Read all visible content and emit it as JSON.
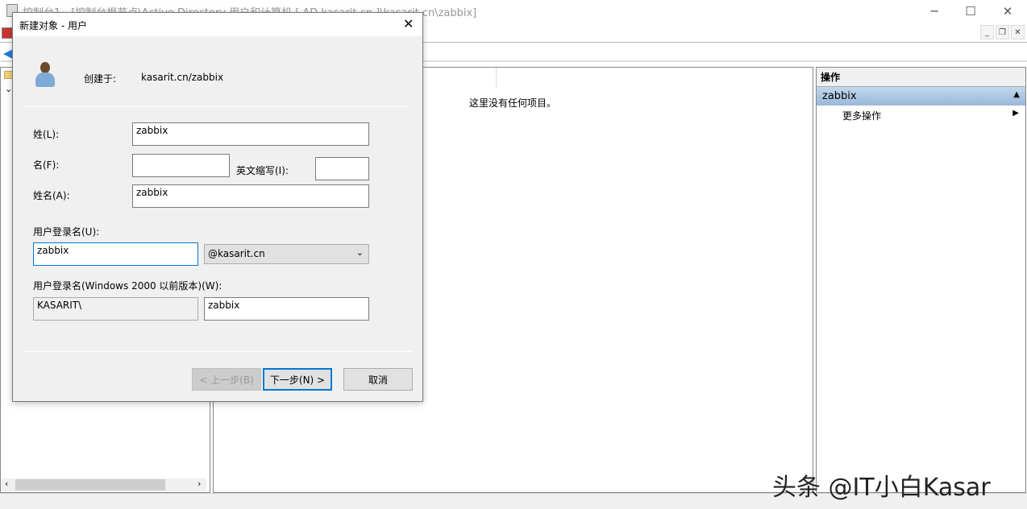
{
  "window": {
    "title": "控制台1 - [控制台根节点\\Active Directory 用户和计算机 [ AD.kasarit.cn ]\\kasarit.cn\\zabbix]"
  },
  "center": {
    "empty_text": "这里没有任何项目。"
  },
  "actions": {
    "header": "操作",
    "selected": "zabbix",
    "more": "更多操作"
  },
  "dialog": {
    "title": "新建对象 - 用户",
    "created_in_label": "创建于:",
    "created_in_value": "kasarit.cn/zabbix",
    "last_name_label": "姓(L):",
    "last_name": "zabbix",
    "first_name_label": "名(F):",
    "first_name": "",
    "initials_label": "英文缩写(I):",
    "initials": "",
    "full_name_label": "姓名(A):",
    "full_name": "zabbix",
    "logon_label": "用户登录名(U):",
    "logon": "zabbix",
    "domain": "@kasarit.cn",
    "legacy_label": "用户登录名(Windows 2000 以前版本)(W):",
    "legacy_domain": "KASARIT\\",
    "legacy_name": "zabbix",
    "back": "< 上一步(B)",
    "next": "下一步(N) >",
    "cancel": "取消"
  },
  "watermark": "头条 @IT小白Kasar"
}
